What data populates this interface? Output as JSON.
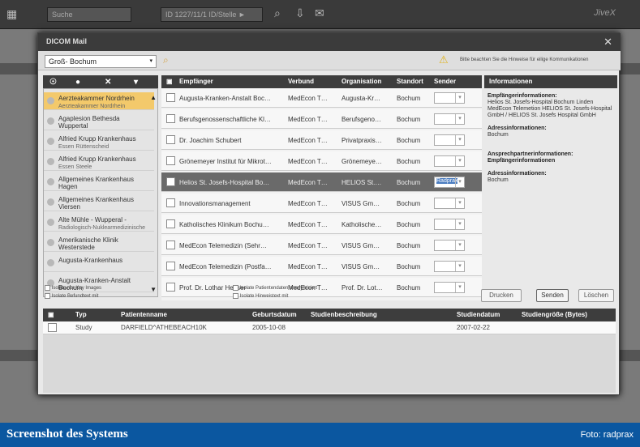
{
  "toolbar": {
    "search_placeholder": "Suche",
    "session": "ID 1227/11/1 ID/Stelle ►",
    "brand": "JiveX"
  },
  "dialog": {
    "title": "DICOM Mail",
    "filter_value": "Groß- Bochum",
    "notice": "Bitte beachten Sie die Hinweise für eilige Kommunikationen"
  },
  "left": {
    "items": [
      {
        "l1": "Aerzteakammer Nordrhein",
        "l2": "Aerzteakammer Nordrhein",
        "sel": true
      },
      {
        "l1": "Agaplesion Bethesda Wuppertal",
        "l2": ""
      },
      {
        "l1": "Alfried Krupp Krankenhaus",
        "l2": "Essen Rüttenscheid"
      },
      {
        "l1": "Alfried Krupp Krankenhaus",
        "l2": "Essen Steele"
      },
      {
        "l1": "Allgemeines Krankenhaus Hagen",
        "l2": ""
      },
      {
        "l1": "Allgemeines Krankenhaus Viersen",
        "l2": ""
      },
      {
        "l1": "Alte Mühle - Wupperal -",
        "l2": "Radiologisch-Nuklearmedizinische Gemeinschaftspraxis"
      },
      {
        "l1": "Amerikanische Klinik Westerstede",
        "l2": ""
      },
      {
        "l1": "Augusta-Krankenhaus",
        "l2": ""
      },
      {
        "l1": "Augusta-Kranken-Anstalt Bochum",
        "l2": ""
      }
    ]
  },
  "grid": {
    "headers": [
      "Empfänger",
      "Verbund",
      "Organisation",
      "Standort",
      "Sender"
    ],
    "rows": [
      {
        "name": "Augusta-Kranken-Anstalt Boc…",
        "verbund": "MedEcon T…",
        "org": "Augusta-Kr…",
        "ort": "Bochum"
      },
      {
        "name": "Berufsgenossenschaftliche Kl…",
        "verbund": "MedEcon T…",
        "org": "Berufsgeno…",
        "ort": "Bochum"
      },
      {
        "name": "Dr. Joachim Schubert",
        "verbund": "MedEcon T…",
        "org": "Privatpraxis…",
        "ort": "Bochum"
      },
      {
        "name": "Grönemeyer Institut für Mikrot…",
        "verbund": "MedEcon T…",
        "org": "Grönemeye…",
        "ort": "Bochum"
      },
      {
        "name": "Helios St. Josefs-Hospital Bo…",
        "verbund": "MedEcon T…",
        "org": "HELIOS St.…",
        "ort": "Bochum",
        "sel": true,
        "sender": "Radprax"
      },
      {
        "name": "Innovationsmanagement",
        "verbund": "MedEcon T…",
        "org": "VISUS Gm…",
        "ort": "Bochum"
      },
      {
        "name": "Katholisches Klinikum Bochu…",
        "verbund": "MedEcon T…",
        "org": "Katholische…",
        "ort": "Bochum"
      },
      {
        "name": "MedEcon Telemedizin (Sehr…",
        "verbund": "MedEcon T…",
        "org": "VISUS Gm…",
        "ort": "Bochum"
      },
      {
        "name": "MedEcon Telemedizin (Postfa…",
        "verbund": "MedEcon T…",
        "org": "VISUS Gm…",
        "ort": "Bochum"
      },
      {
        "name": "Prof. Dr. Lothar Heuser",
        "verbund": "MedEcon T…",
        "org": "Prof. Dr. Lot…",
        "ort": "Bochum"
      }
    ]
  },
  "info": {
    "h1": "Informationen",
    "h2": "Empfängerinformationen:",
    "t2": "Helios St. Josefs-Hospital Bochum Linden MedEcon Telemetion HELIOS St. Josefs-Hospital GmbH / HELIOS St. Josefs Hospital GmbH",
    "h3": "Adressinformationen:",
    "t3": "Bochum",
    "h4": "Ansprechpartnerinformationen:",
    "t4": "Empfängerinformationen",
    "h5": "Adressinformationen:",
    "t5": "Bochum"
  },
  "options": {
    "o1": "Isolate nur Key Images",
    "o2": "Isolate Befundtext mit",
    "o3": "Isolate Patientendaten anonymisiert",
    "o4": "Isolate Hinweistext mit"
  },
  "buttons": {
    "print": "Drucken",
    "send": "Senden",
    "delete": "Löschen"
  },
  "bottom": {
    "headers": [
      "Typ",
      "Patientenname",
      "Geburtsdatum",
      "Studienbeschreibung",
      "Studiendatum",
      "Studiengröße (Bytes)"
    ],
    "row": {
      "typ": "Study",
      "name": "DARFIELD^ATHEBEACH10K",
      "birth": "2005-10-08",
      "date": "2007-02-22"
    }
  },
  "caption": {
    "left": "Screenshot des Systems",
    "right": "Foto: radprax"
  }
}
